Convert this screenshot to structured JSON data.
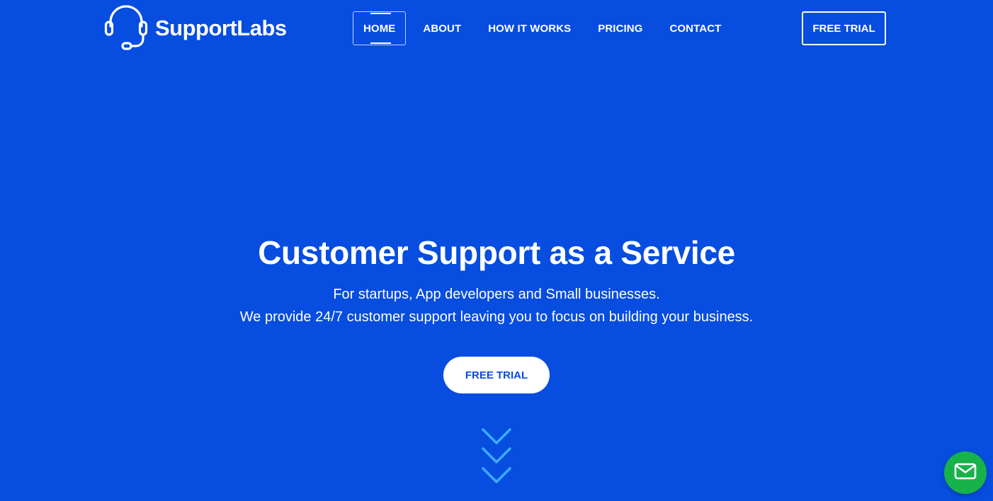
{
  "brand": {
    "name": "SupportLabs",
    "logo_icon": "headset-icon"
  },
  "nav": {
    "items": [
      {
        "label": "HOME",
        "active": true
      },
      {
        "label": "ABOUT",
        "active": false
      },
      {
        "label": "HOW IT WORKS",
        "active": false
      },
      {
        "label": "PRICING",
        "active": false
      },
      {
        "label": "CONTACT",
        "active": false
      }
    ],
    "cta_label": "FREE TRIAL"
  },
  "hero": {
    "title": "Customer Support as a Service",
    "subtitle_line1": "For startups, App developers and Small businesses.",
    "subtitle_line2": "We provide 24/7 customer support leaving you to focus on building your business.",
    "cta_label": "FREE TRIAL",
    "scroll_icon": "triple-chevron-down-icon"
  },
  "chat_widget": {
    "icon": "mail-icon",
    "color": "#17b34a"
  },
  "colors": {
    "background": "#064de0",
    "text": "#ffffff",
    "cta_text": "#0a4be0",
    "chevron": "#3fa9ff"
  }
}
